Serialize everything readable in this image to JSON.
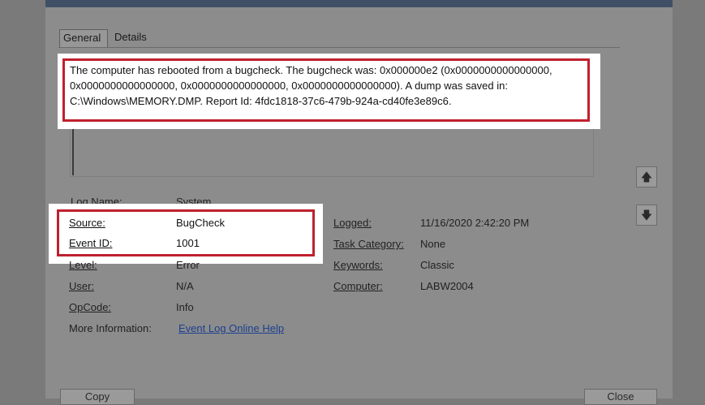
{
  "tabs": [
    {
      "label": "General",
      "active": true
    },
    {
      "label": "Details",
      "active": false
    }
  ],
  "description": "The computer has rebooted from a bugcheck.  The bugcheck was: 0x000000e2 (0x0000000000000000, 0x0000000000000000, 0x0000000000000000, 0x0000000000000000). A dump was saved in: C:\\Windows\\MEMORY.DMP. Report Id: 4fdc1818-37c6-479b-924a-cd40fe3e89c6.",
  "fields": {
    "log_name": {
      "label": "Log Name:",
      "value": "System"
    },
    "source": {
      "label": "Source:",
      "value": "BugCheck"
    },
    "event_id": {
      "label": "Event ID:",
      "value": "1001"
    },
    "level": {
      "label": "Level:",
      "value": "Error"
    },
    "user": {
      "label": "User:",
      "value": "N/A"
    },
    "opcode": {
      "label": "OpCode:",
      "value": "Info"
    },
    "more_info": {
      "label": "More Information:",
      "value": "Event Log Online Help"
    },
    "logged": {
      "label": "Logged:",
      "value": "11/16/2020 2:42:20 PM"
    },
    "task_category": {
      "label": "Task Category:",
      "value": "None"
    },
    "keywords": {
      "label": "Keywords:",
      "value": "Classic"
    },
    "computer": {
      "label": "Computer:",
      "value": "LABW2004"
    }
  },
  "buttons": {
    "copy": "Copy",
    "close": "Close"
  },
  "icons": {
    "scroll_up": "up-arrow-icon",
    "scroll_down": "down-arrow-icon"
  },
  "colors": {
    "highlight_border": "#c0202e",
    "link": "#1d3f8f"
  }
}
